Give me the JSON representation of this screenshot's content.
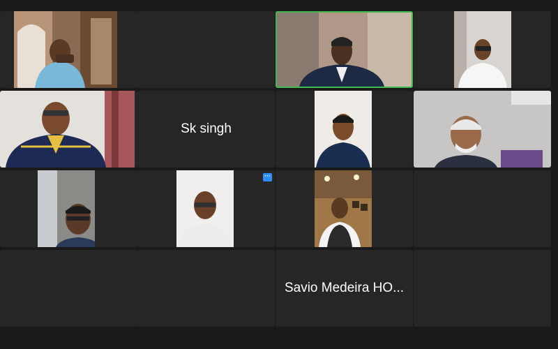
{
  "meeting": {
    "participants": [
      {
        "id": "p1",
        "label": "",
        "has_video": true
      },
      {
        "id": "p2",
        "label": "",
        "has_video": false
      },
      {
        "id": "p3",
        "label": "",
        "has_video": true,
        "active_speaker": true
      },
      {
        "id": "p4",
        "label": "",
        "has_video": true
      },
      {
        "id": "p5",
        "label": "",
        "has_video": true
      },
      {
        "id": "p6",
        "label": "Sk singh",
        "has_video": false
      },
      {
        "id": "p7",
        "label": "",
        "has_video": true
      },
      {
        "id": "p8",
        "label": "",
        "has_video": true
      },
      {
        "id": "p9",
        "label": "",
        "has_video": true
      },
      {
        "id": "p10",
        "label": "",
        "has_video": true,
        "has_more_menu": true
      },
      {
        "id": "p11",
        "label": "",
        "has_video": true
      },
      {
        "id": "p12",
        "label": "",
        "has_video": false
      },
      {
        "id": "p13",
        "label": "",
        "has_video": false
      },
      {
        "id": "p14",
        "label": "",
        "has_video": false
      },
      {
        "id": "p15",
        "label": "Savio Medeira HO...",
        "has_video": false
      },
      {
        "id": "p16",
        "label": "",
        "has_video": false
      }
    ],
    "more_button_glyph": "···"
  },
  "colors": {
    "background": "#1a1a1a",
    "tile": "#262626",
    "active_border": "#3fb950",
    "accent": "#2d8cff"
  }
}
